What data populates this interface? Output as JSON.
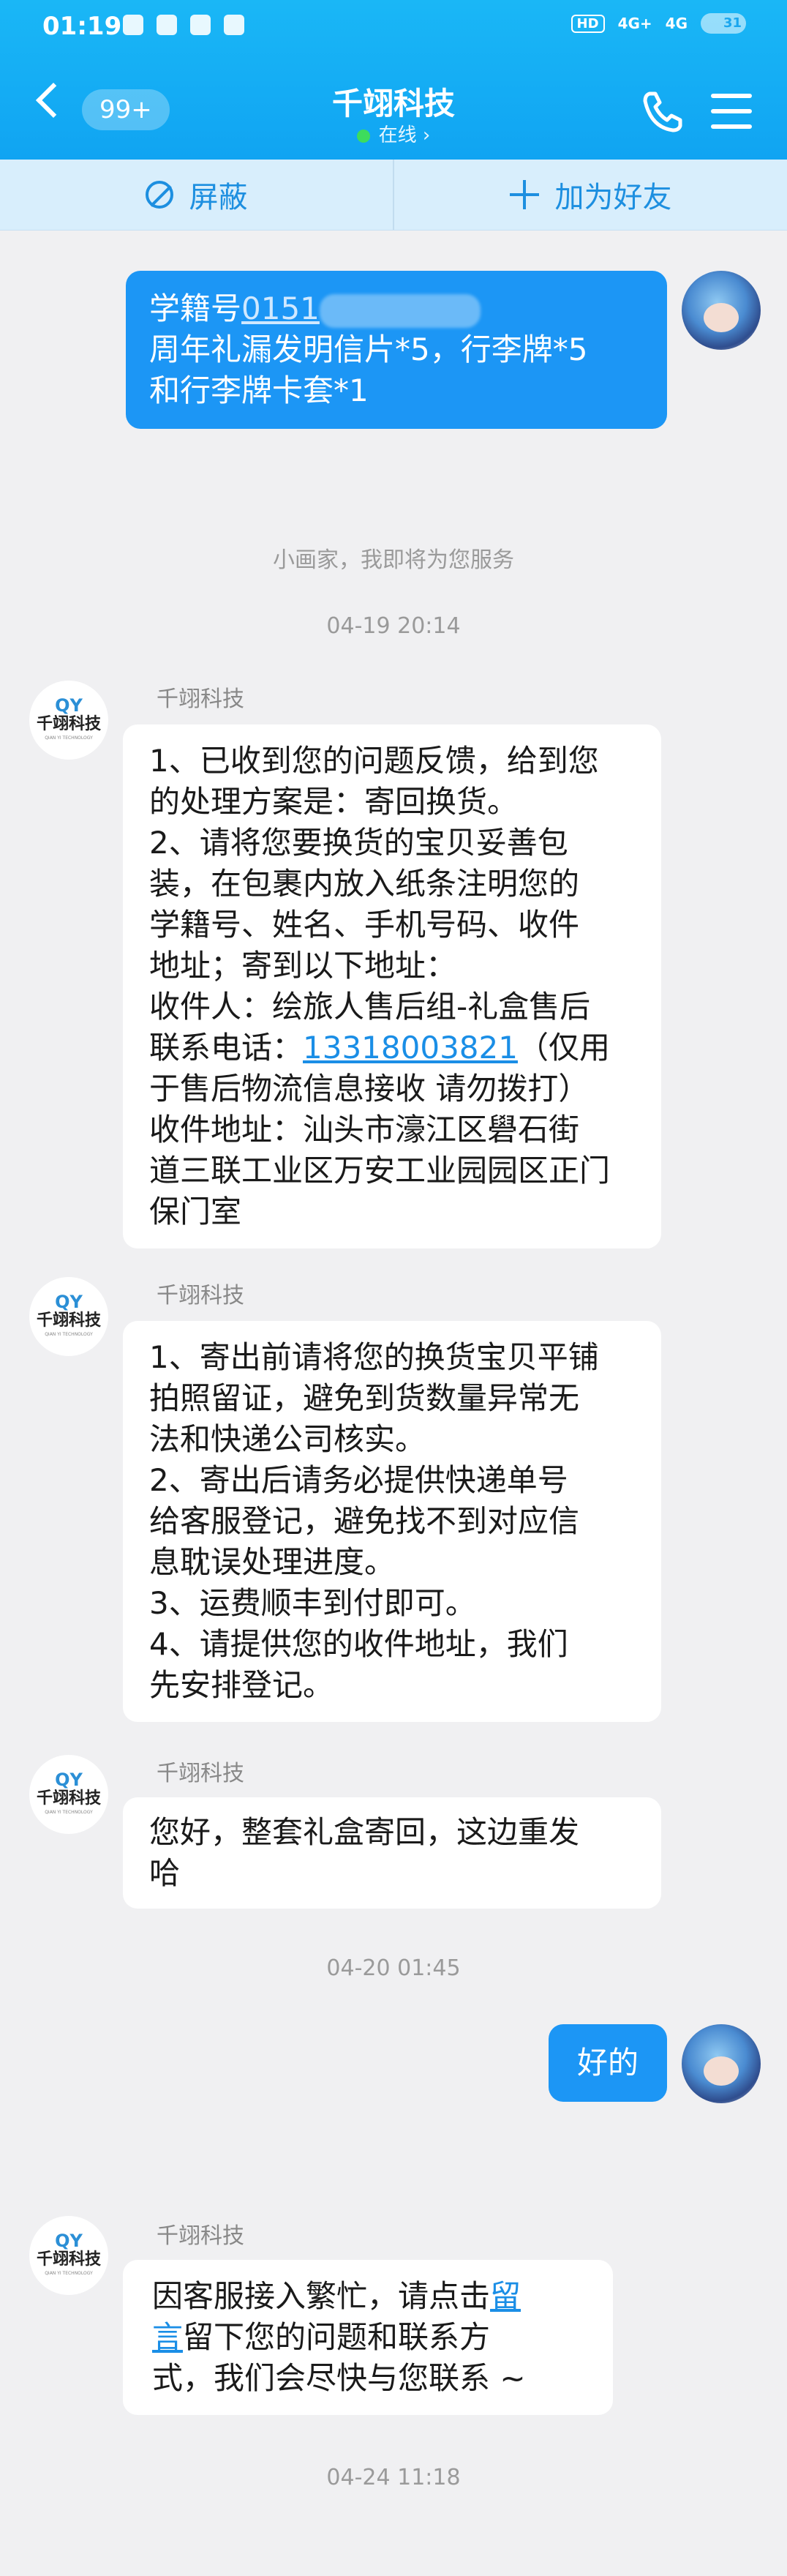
{
  "status_bar": {
    "time": "01:19",
    "network_badge": "HD",
    "signal1": "4G+",
    "signal2": "4G",
    "battery": "31"
  },
  "header": {
    "back_count": "99+",
    "title": "千翊科技",
    "status": "在线 ›"
  },
  "actions": {
    "block_label": "屏蔽",
    "add_friend_label": "加为好友"
  },
  "messages": {
    "m1": {
      "prefix": "学籍号",
      "id_partial": "0151",
      "rest": "\n周年礼漏发明信片*5，行李牌*5\n和行李牌卡套*1"
    },
    "sys_service": "小画家，我即将为您服务",
    "time1": "04-19 20:14",
    "agent_name": "千翊科技",
    "m2": {
      "part1": "1、已收到您的问题反馈，给到您\n的处理方案是：寄回换货。\n2、请将您要换货的宝贝妥善包\n装，在包裹内放入纸条注明您的\n学籍号、姓名、手机号码、收件\n地址；寄到以下地址：\n收件人：绘旅人售后组-礼盒售后\n联系电话：",
      "phone": "13318003821",
      "part2": "（仅用\n于售后物流信息接收 请勿拨打）\n收件地址：汕头市濠江区礐石街\n道三联工业区万安工业园园区正门\n保门室"
    },
    "m3": "1、寄出前请将您的换货宝贝平铺\n拍照留证，避免到货数量异常无\n法和快递公司核实。\n2、寄出后请务必提供快递单号\n给客服登记，避免找不到对应信\n息耽误处理进度。\n3、运费顺丰到付即可。\n4、请提供您的收件地址，我们\n先安排登记。",
    "m4": "您好，整套礼盒寄回，这边重发\n哈",
    "time2": "04-20 01:45",
    "m5": "好的",
    "m6": {
      "part1": "因客服接入繁忙，请点击",
      "link": "留\n言",
      "part2": "留下您的问题和联系方\n式，我们会尽快与您联系 ~"
    },
    "time3": "04-24 11:18"
  },
  "avatar_agent": {
    "logo_mark": "QY",
    "logo_text": "千翊科技",
    "logo_sub": "QIAN YI TECHNOLOGY"
  }
}
